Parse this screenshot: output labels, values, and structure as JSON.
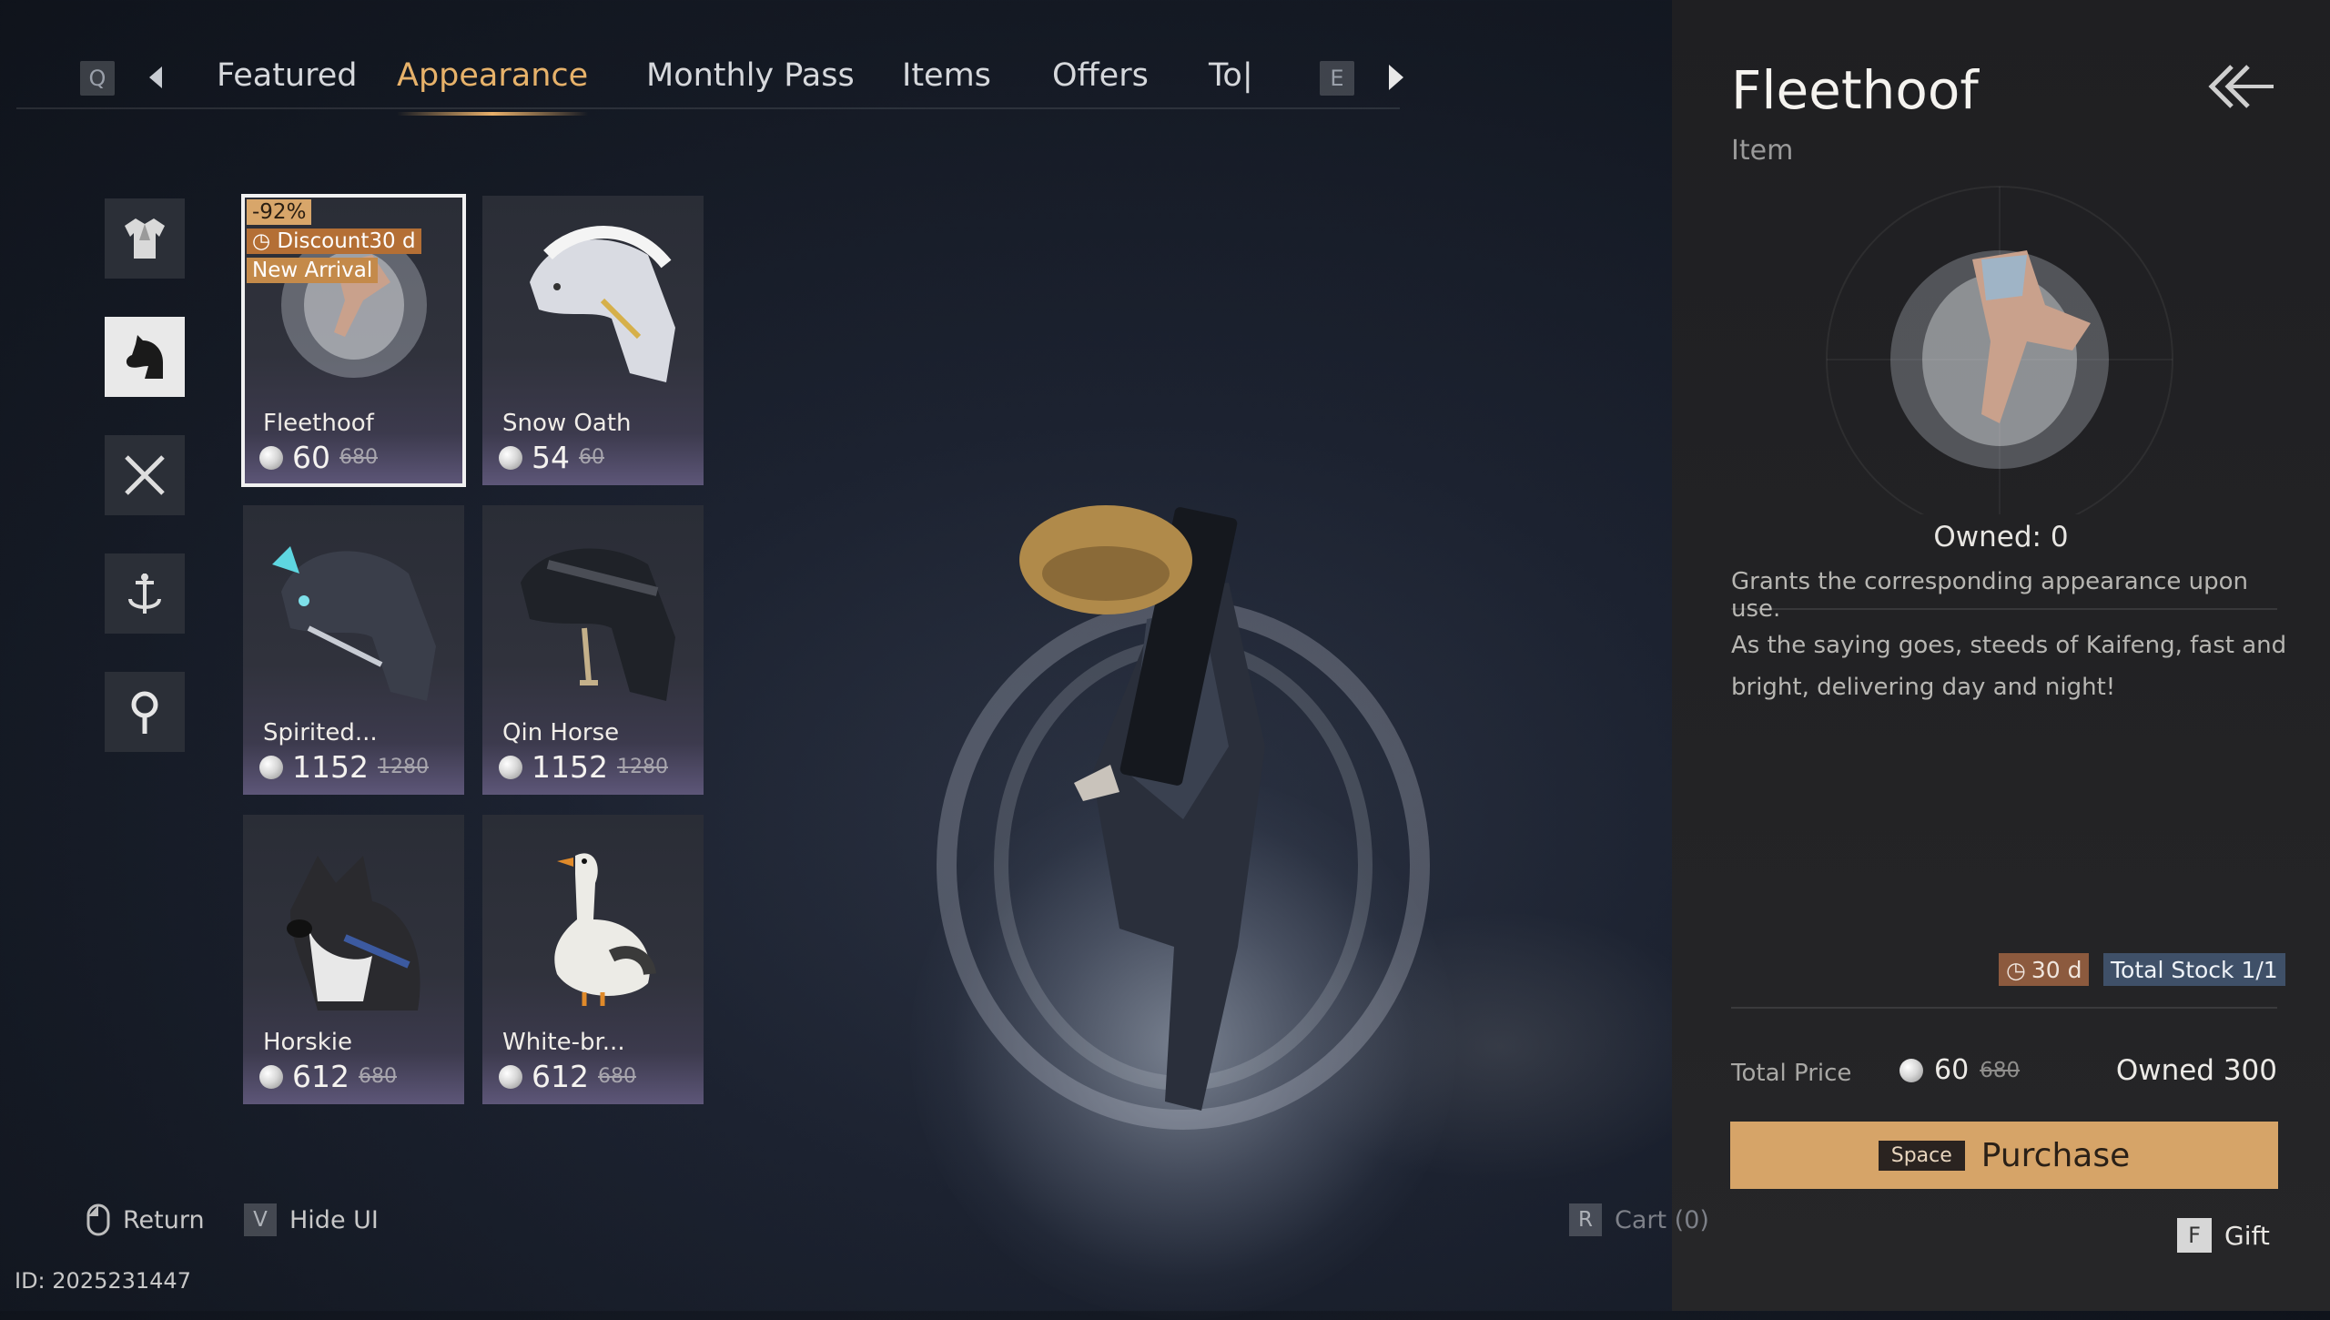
{
  "nav": {
    "prev_key": "Q",
    "next_key": "E",
    "tabs": [
      {
        "label": "Featured"
      },
      {
        "label": "Appearance"
      },
      {
        "label": "Monthly Pass"
      },
      {
        "label": "Items"
      },
      {
        "label": "Offers"
      },
      {
        "label": "To|"
      }
    ],
    "active_tab": "Appearance"
  },
  "categories": [
    {
      "icon": "outfit-icon"
    },
    {
      "icon": "horse-head-icon",
      "active": true
    },
    {
      "icon": "crossed-swords-icon"
    },
    {
      "icon": "anchor-trident-icon"
    },
    {
      "icon": "location-pin-icon"
    }
  ],
  "items": [
    {
      "name": "Fleethoof",
      "price": "60",
      "original_price": "680",
      "selected": true,
      "tags": {
        "discount": "-92%",
        "timer": "Discount30 d",
        "new": "New Arrival"
      }
    },
    {
      "name": "Snow Oath",
      "price": "54",
      "original_price": "60"
    },
    {
      "name": "Spirited...",
      "price": "1152",
      "original_price": "1280"
    },
    {
      "name": "Qin Horse",
      "price": "1152",
      "original_price": "1280"
    },
    {
      "name": "Horskie",
      "price": "612",
      "original_price": "680"
    },
    {
      "name": "White-br...",
      "price": "612",
      "original_price": "680"
    }
  ],
  "detail": {
    "title": "Fleethoof",
    "type": "Item",
    "owned": "Owned: 0",
    "description": "Grants the corresponding appearance upon use.",
    "flavor": "As the saying goes, steeds of Kaifeng, fast and bright, delivering day and night!",
    "duration": "30 d",
    "stock": "Total Stock 1/1",
    "total_price_label": "Total Price",
    "total_price": "60",
    "total_price_original": "680",
    "owned_currency": "Owned 300",
    "purchase_key": "Space",
    "purchase_label": "Purchase",
    "gift_key": "F",
    "gift_label": "Gift"
  },
  "bottom": {
    "return_label": "Return",
    "hide_ui_key": "V",
    "hide_ui_label": "Hide UI",
    "cart_key": "R",
    "cart_label": "Cart (0)",
    "id_text": "ID: 2025231447"
  },
  "colors": {
    "accent": "#e7b26a",
    "purchase_button": "#d6a468",
    "discount_tag": "#c48a4a",
    "stock_badge": "#3f5068"
  }
}
